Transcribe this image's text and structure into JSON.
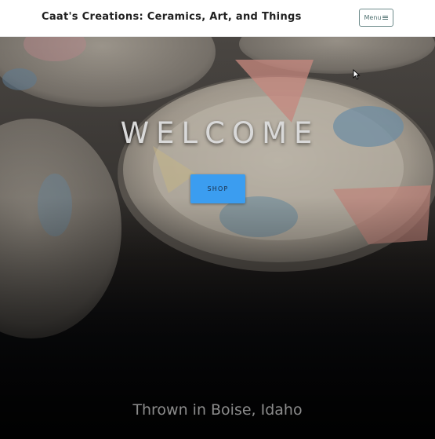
{
  "navbar": {
    "brand": "Caat's Creations: Ceramics, Art, and Things",
    "menu_label": "Menu",
    "menu_icon": "bars-icon"
  },
  "hero": {
    "heading": "WELCOME",
    "shop_label": "SHOP",
    "tagline": "Thrown in Boise, Idaho",
    "background_image": "ceramic-plates-photo"
  },
  "colors": {
    "accent": "#3b9df0",
    "navbar_bg": "#ffffff",
    "menu_border": "#6f8c8c",
    "page_bg": "#0b0c0f"
  }
}
